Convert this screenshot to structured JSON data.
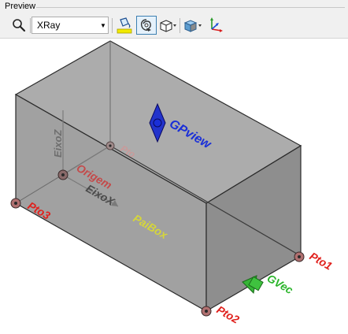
{
  "panel": {
    "title": "Preview"
  },
  "toolbar": {
    "render_mode": {
      "selected": "XRay"
    },
    "buttons": [
      {
        "icon": "zoom-magnifier-icon"
      },
      {
        "icon": "fill-color-bucket-icon"
      },
      {
        "icon": "rotate-view-icon"
      },
      {
        "icon": "cube-view-icon"
      },
      {
        "icon": "display-mode-cube-icon"
      },
      {
        "icon": "axes-triad-icon"
      }
    ]
  },
  "viewport": {
    "labels": {
      "gpview": "GPview",
      "pto": "Pto",
      "origem": "Origem",
      "eixo_x": "EixoX",
      "eixo_z": "EixoZ",
      "pto3": "Pto3",
      "paibox": "PaiBox",
      "pto1": "Pto1",
      "gvec": "GVec",
      "pto2": "Pto2"
    },
    "colors": {
      "box_face": "#a6a6a6",
      "box_edge": "#2a2a2a",
      "point_label": "#e0201c",
      "gpview": "#1a2fd8",
      "paibox": "#d6d63a",
      "gvec": "#2cb52c",
      "axis_label": "#6e6e6e"
    }
  }
}
